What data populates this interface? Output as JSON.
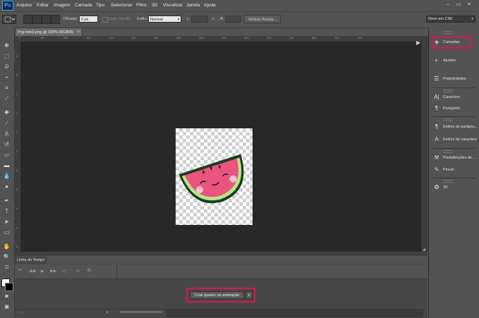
{
  "app": {
    "logo": "Ps"
  },
  "menu": [
    "Arquivo",
    "Editar",
    "Imagem",
    "Camada",
    "Tipo",
    "Selecionar",
    "Filtro",
    "3D",
    "Visualizar",
    "Janela",
    "Ajuda"
  ],
  "window_controls": {
    "minimize": "–",
    "restore": "▭",
    "close": "✕"
  },
  "options_bar": {
    "feather_label": "Difusão:",
    "feather_value": "0 px",
    "antialias_label": "Suav. Serrilh.",
    "style_label": "Estilo:",
    "style_value": "Normal",
    "width_label": "L:",
    "height_label": "A:",
    "refine_button": "Refinar Aresta...",
    "workspace": "Novo em CS6"
  },
  "document": {
    "tab_label": "Png foto2.png @ 100% (RGB/8)"
  },
  "rulers": {
    "top": [
      "0",
      "50",
      "100",
      "150",
      "200",
      "250",
      "300",
      "350",
      "400",
      "450",
      "500",
      "550",
      "600",
      "650",
      "700",
      "750"
    ],
    "left": [
      "0",
      "5",
      "1",
      "1",
      "2",
      "2",
      "3",
      "3",
      "4",
      "4",
      "5"
    ]
  },
  "timeline": {
    "tab_label": "Linha do Tempo",
    "create_frame_button": "Criar quadro de animação",
    "dropdown_arrow": "▾"
  },
  "right_panels": {
    "groups": [
      [
        {
          "label": "Camadas",
          "icon": "layers-icon"
        },
        {
          "label": "Ajustes",
          "icon": "adjustments-icon"
        },
        {
          "label": "Propriedades",
          "icon": "properties-icon"
        }
      ],
      [
        {
          "label": "Caractere",
          "icon": "character-icon"
        },
        {
          "label": "Parágrafo",
          "icon": "paragraph-icon"
        }
      ],
      [
        {
          "label": "Estilos de parágra...",
          "icon": "paragraph-styles-icon"
        },
        {
          "label": "Estilos de caractere",
          "icon": "character-styles-icon"
        }
      ],
      [
        {
          "label": "Predefinições de ...",
          "icon": "tool-presets-icon"
        },
        {
          "label": "Pincel",
          "icon": "brush-icon"
        },
        {
          "label": "3D",
          "icon": "3d-icon"
        }
      ]
    ]
  },
  "colors": {
    "accent_highlight": "#d9174f",
    "foreground": "#ffffff",
    "background": "#000000"
  }
}
